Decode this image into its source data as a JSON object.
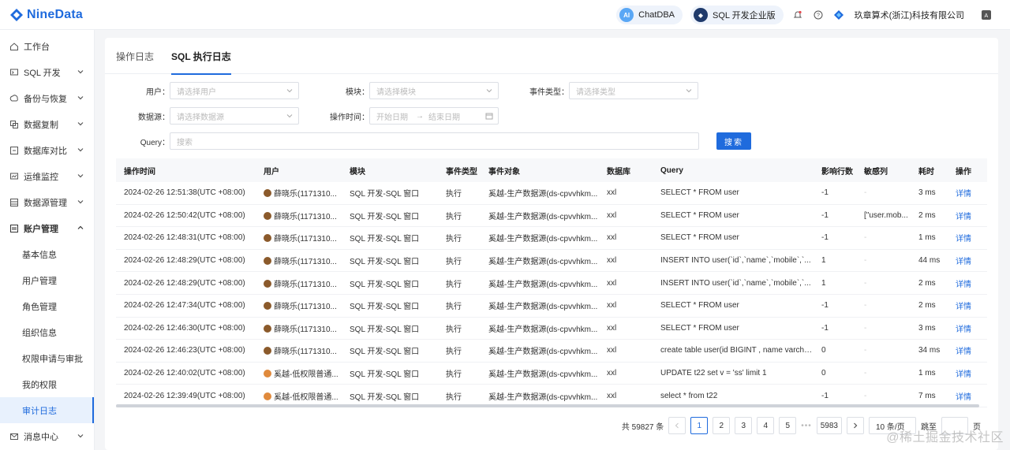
{
  "app": {
    "name": "NineData",
    "brand_color": "#1f6bdd"
  },
  "header": {
    "chatdba_label": "ChatDBA",
    "sql_edition_label": "SQL 开发企业版",
    "company_name": "玖章算术(浙江)科技有限公司"
  },
  "sidebar": {
    "items": [
      {
        "label": "工作台",
        "icon": "home-icon"
      },
      {
        "label": "SQL 开发",
        "icon": "sql-icon"
      },
      {
        "label": "备份与恢复",
        "icon": "backup-icon"
      },
      {
        "label": "数据复制",
        "icon": "copy-icon"
      },
      {
        "label": "数据库对比",
        "icon": "compare-icon"
      },
      {
        "label": "运维监控",
        "icon": "monitor-icon"
      },
      {
        "label": "数据源管理",
        "icon": "datasource-icon"
      },
      {
        "label": "账户管理",
        "icon": "account-icon"
      }
    ],
    "sub_items": [
      {
        "label": "基本信息"
      },
      {
        "label": "用户管理"
      },
      {
        "label": "角色管理"
      },
      {
        "label": "组织信息"
      },
      {
        "label": "权限申请与审批"
      },
      {
        "label": "我的权限"
      },
      {
        "label": "审计日志"
      }
    ],
    "bottom_item": {
      "label": "消息中心",
      "icon": "message-icon"
    }
  },
  "tabs": [
    {
      "label": "操作日志"
    },
    {
      "label": "SQL 执行日志"
    }
  ],
  "filters": {
    "user_label": "用户：",
    "user_placeholder": "请选择用户",
    "module_label": "模块：",
    "module_placeholder": "请选择模块",
    "event_type_label": "事件类型：",
    "event_type_placeholder": "请选择类型",
    "datasource_label": "数据源：",
    "datasource_placeholder": "请选择数据源",
    "time_label": "操作时间：",
    "start_placeholder": "开始日期",
    "end_placeholder": "结束日期",
    "query_label": "Query：",
    "query_placeholder": "搜索",
    "search_button": "搜索"
  },
  "table": {
    "columns": [
      "操作时间",
      "用户",
      "模块",
      "事件类型",
      "事件对象",
      "数据库",
      "Query",
      "影响行数",
      "敏感列",
      "耗时",
      "操作"
    ],
    "rows": [
      {
        "time": "2024-02-26 12:51:38(UTC +08:00)",
        "user": "薛晓乐(1171310...",
        "avatar": "#8b5a2b",
        "module": "SQL 开发-SQL 窗口",
        "event": "执行",
        "target": "奚越-生产数据源(ds-cpvvhkm...",
        "db": "xxl",
        "query": "SELECT * FROM user",
        "rows": "-1",
        "sensitive": "-",
        "cost": "3 ms",
        "action": "详情"
      },
      {
        "time": "2024-02-26 12:50:42(UTC +08:00)",
        "user": "薛晓乐(1171310...",
        "avatar": "#8b5a2b",
        "module": "SQL 开发-SQL 窗口",
        "event": "执行",
        "target": "奚越-生产数据源(ds-cpvvhkm...",
        "db": "xxl",
        "query": "SELECT * FROM user",
        "rows": "-1",
        "sensitive": "[\"user.mob...",
        "cost": "2 ms",
        "action": "详情"
      },
      {
        "time": "2024-02-26 12:48:31(UTC +08:00)",
        "user": "薛晓乐(1171310...",
        "avatar": "#8b5a2b",
        "module": "SQL 开发-SQL 窗口",
        "event": "执行",
        "target": "奚越-生产数据源(ds-cpvvhkm...",
        "db": "xxl",
        "query": "SELECT * FROM user",
        "rows": "-1",
        "sensitive": "-",
        "cost": "1 ms",
        "action": "详情"
      },
      {
        "time": "2024-02-26 12:48:29(UTC +08:00)",
        "user": "薛晓乐(1171310...",
        "avatar": "#8b5a2b",
        "module": "SQL 开发-SQL 窗口",
        "event": "执行",
        "target": "奚越-生产数据源(ds-cpvvhkm...",
        "db": "xxl",
        "query": "INSERT INTO user(`id`,`name`,`mobile`,`...",
        "rows": "1",
        "sensitive": "-",
        "cost": "44 ms",
        "action": "详情"
      },
      {
        "time": "2024-02-26 12:48:29(UTC +08:00)",
        "user": "薛晓乐(1171310...",
        "avatar": "#8b5a2b",
        "module": "SQL 开发-SQL 窗口",
        "event": "执行",
        "target": "奚越-生产数据源(ds-cpvvhkm...",
        "db": "xxl",
        "query": "INSERT INTO user(`id`,`name`,`mobile`,`...",
        "rows": "1",
        "sensitive": "-",
        "cost": "2 ms",
        "action": "详情"
      },
      {
        "time": "2024-02-26 12:47:34(UTC +08:00)",
        "user": "薛晓乐(1171310...",
        "avatar": "#8b5a2b",
        "module": "SQL 开发-SQL 窗口",
        "event": "执行",
        "target": "奚越-生产数据源(ds-cpvvhkm...",
        "db": "xxl",
        "query": "SELECT * FROM user",
        "rows": "-1",
        "sensitive": "-",
        "cost": "2 ms",
        "action": "详情"
      },
      {
        "time": "2024-02-26 12:46:30(UTC +08:00)",
        "user": "薛晓乐(1171310...",
        "avatar": "#8b5a2b",
        "module": "SQL 开发-SQL 窗口",
        "event": "执行",
        "target": "奚越-生产数据源(ds-cpvvhkm...",
        "db": "xxl",
        "query": "SELECT * FROM user",
        "rows": "-1",
        "sensitive": "-",
        "cost": "3 ms",
        "action": "详情"
      },
      {
        "time": "2024-02-26 12:46:23(UTC +08:00)",
        "user": "薛晓乐(1171310...",
        "avatar": "#8b5a2b",
        "module": "SQL 开发-SQL 窗口",
        "event": "执行",
        "target": "奚越-生产数据源(ds-cpvvhkm...",
        "db": "xxl",
        "query": "create table user(id BIGINT , name varcha...",
        "rows": "0",
        "sensitive": "-",
        "cost": "34 ms",
        "action": "详情"
      },
      {
        "time": "2024-02-26 12:40:02(UTC +08:00)",
        "user": "奚越-低权限普通...",
        "avatar": "#e08a3c",
        "module": "SQL 开发-SQL 窗口",
        "event": "执行",
        "target": "奚越-生产数据源(ds-cpvvhkm...",
        "db": "xxl",
        "query": "UPDATE t22 set v = 'ss' limit 1",
        "rows": "0",
        "sensitive": "-",
        "cost": "1 ms",
        "action": "详情"
      },
      {
        "time": "2024-02-26 12:39:49(UTC +08:00)",
        "user": "奚越-低权限普通...",
        "avatar": "#e08a3c",
        "module": "SQL 开发-SQL 窗口",
        "event": "执行",
        "target": "奚越-生产数据源(ds-cpvvhkm...",
        "db": "xxl",
        "query": "select * from t22",
        "rows": "-1",
        "sensitive": "-",
        "cost": "7 ms",
        "action": "详情"
      }
    ]
  },
  "pagination": {
    "total_text": "共 59827 条",
    "pages": [
      "1",
      "2",
      "3",
      "4",
      "5"
    ],
    "ellipsis": "•••",
    "last_page": "5983",
    "page_size": "10 条/页",
    "jump_label": "跳至",
    "page_unit": "页"
  },
  "watermark_text": "@稀土掘金技术社区"
}
